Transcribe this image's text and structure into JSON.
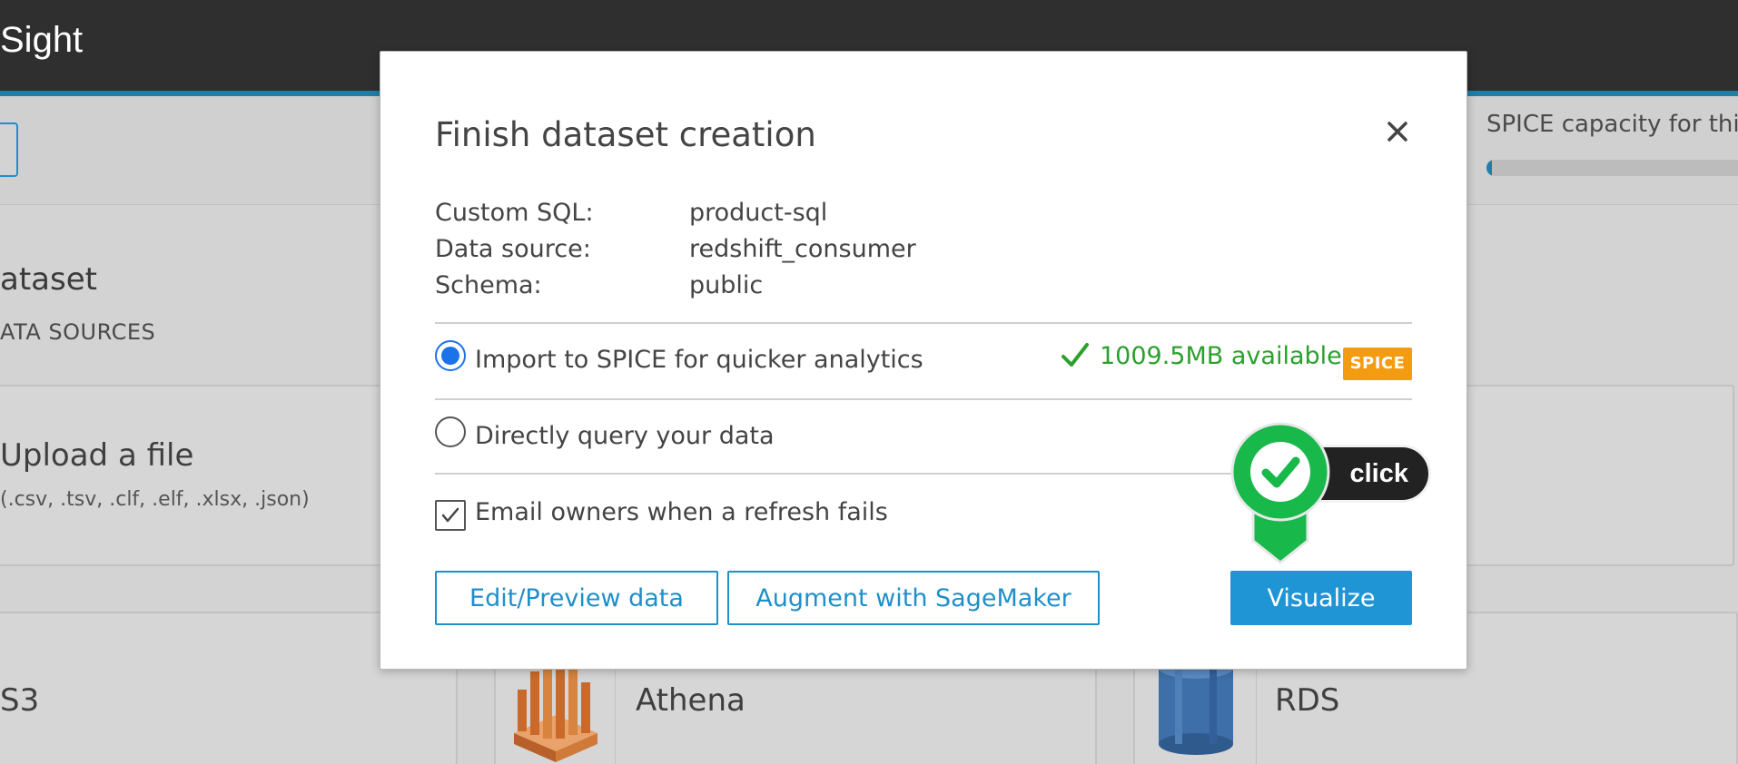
{
  "app": {
    "title": "Sight"
  },
  "background": {
    "heading": "ataset",
    "subheading": "ATA SOURCES",
    "upload_title": "Upload a file",
    "upload_sub": "(.csv, .tsv, .clf, .elf, .xlsx, .json)",
    "s3_label": "S3",
    "athena_label": "Athena",
    "rds_label": "RDS",
    "spice_capacity_label": "SPICE capacity for this",
    "spice_capacity_fraction": 0.02
  },
  "dialog": {
    "title": "Finish dataset creation",
    "info": [
      {
        "label": "Custom SQL:",
        "value": "product-sql"
      },
      {
        "label": "Data source:",
        "value": "redshift_consumer"
      },
      {
        "label": "Schema:",
        "value": "public"
      }
    ],
    "import_option": "Import to SPICE for quicker analytics",
    "direct_option": "Directly query your data",
    "available": "1009.5MB available",
    "spice_badge": "SPICE",
    "email_option": "Email owners when a refresh fails",
    "buttons": {
      "edit": "Edit/Preview data",
      "augment": "Augment with SageMaker",
      "visualize": "Visualize"
    }
  },
  "annotation": {
    "click_label": "click"
  },
  "colors": {
    "accent": "#1f95d6",
    "success": "#2ca02c",
    "badge": "#f39c12",
    "pin": "#19b84a"
  }
}
